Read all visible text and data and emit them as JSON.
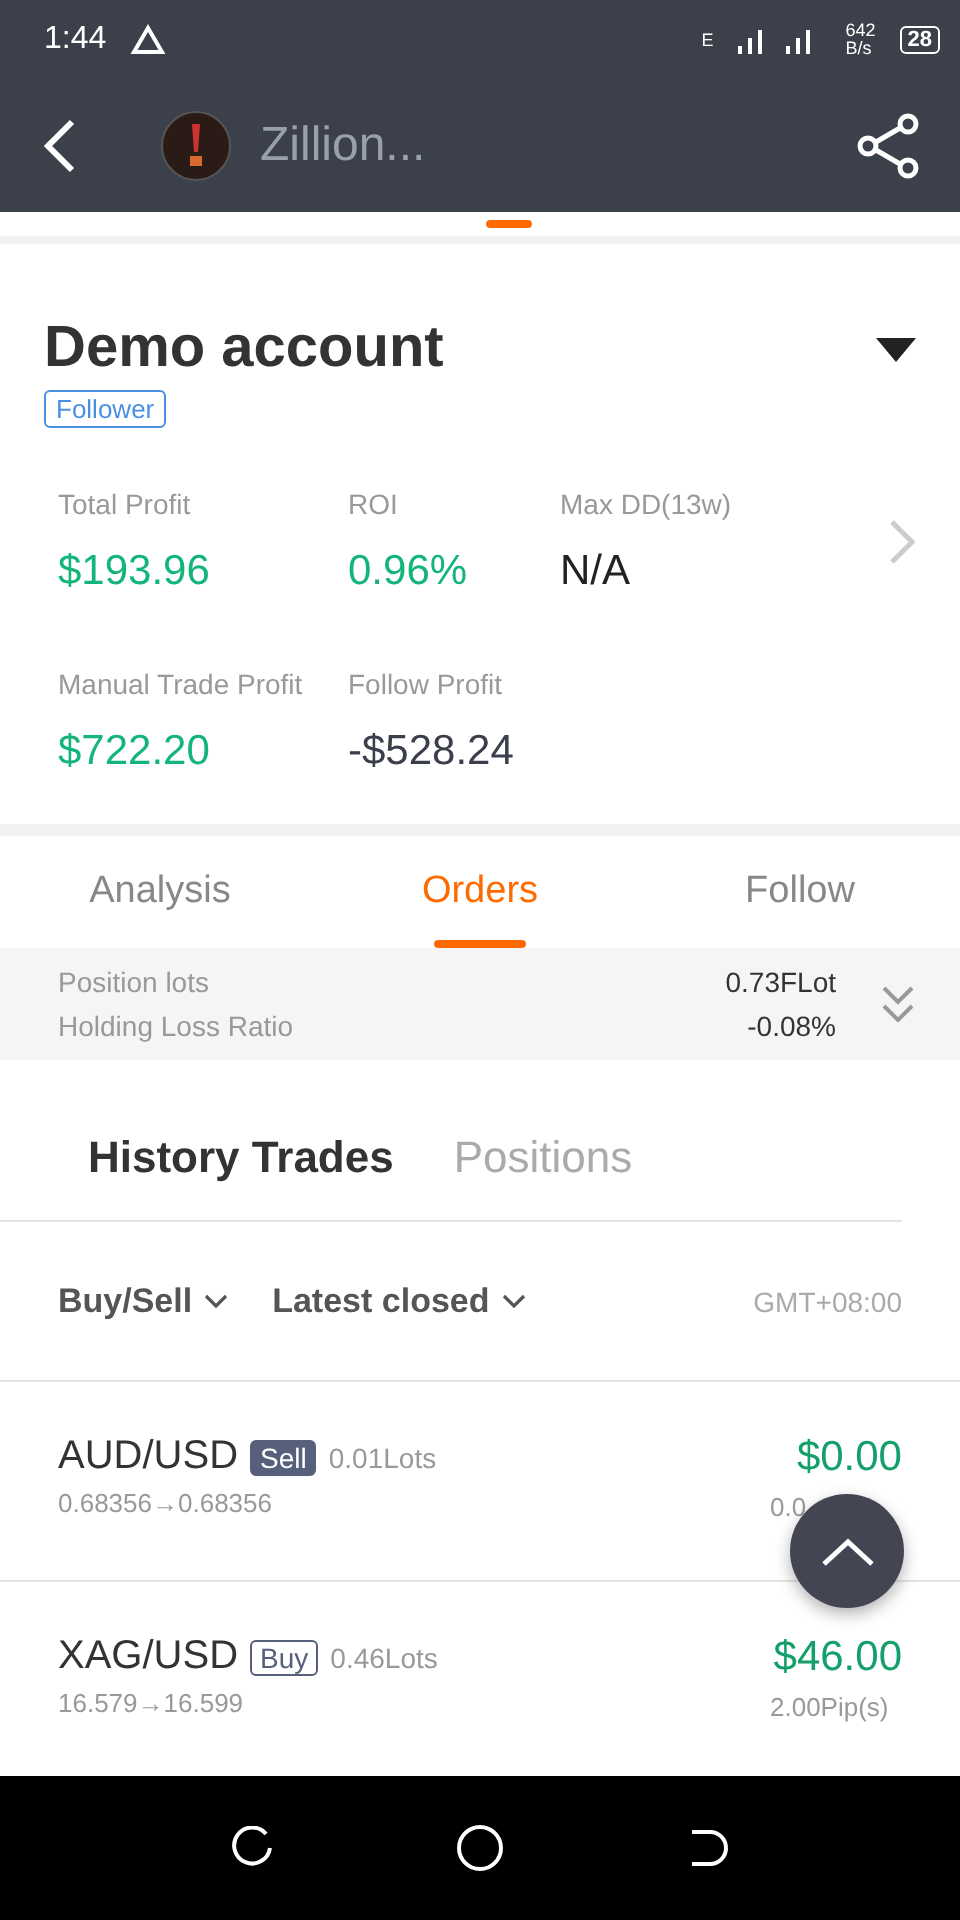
{
  "status_bar": {
    "time": "1:44",
    "network_letter": "E",
    "speed_value": "642",
    "speed_unit": "B/s",
    "battery": "28"
  },
  "header": {
    "title": "Zillion..."
  },
  "account": {
    "name": "Demo account",
    "badge": "Follower",
    "stats": [
      {
        "label": "Total Profit",
        "value": "$193.96",
        "color": "#14b57a"
      },
      {
        "label": "ROI",
        "value": "0.96%",
        "color": "#14b57a"
      },
      {
        "label": "Max DD(13w)",
        "value": "N/A",
        "color": "#222222"
      },
      {
        "label": "Manual Trade Profit",
        "value": "$722.20",
        "color": "#14b57a"
      },
      {
        "label": "Follow Profit",
        "value": "-$528.24",
        "color": "#3a3f4b"
      }
    ]
  },
  "tabs": [
    {
      "label": "Analysis",
      "selected": false
    },
    {
      "label": "Orders",
      "selected": true
    },
    {
      "label": "Follow",
      "selected": false
    }
  ],
  "summary": [
    {
      "label": "Position lots",
      "value": "0.73FLot"
    },
    {
      "label": "Holding Loss Ratio",
      "value": "-0.08%"
    }
  ],
  "subtabs": [
    {
      "label": "History Trades",
      "selected": true
    },
    {
      "label": "Positions",
      "selected": false
    }
  ],
  "filters": [
    {
      "label": "Buy/Sell"
    },
    {
      "label": "Latest closed"
    }
  ],
  "timezone": "GMT+08:00",
  "trades": [
    {
      "symbol": "AUD/USD",
      "side": "Sell",
      "kind": "sell",
      "lots": "0.01Lots",
      "prices": "0.68356→0.68356",
      "profit": "$0.00",
      "pips": "0.0"
    },
    {
      "symbol": "XAG/USD",
      "side": "Buy",
      "kind": "buy",
      "lots": "0.46Lots",
      "prices": "16.579→16.599",
      "profit": "$46.00",
      "pips": "2.00Pip(s)"
    }
  ]
}
